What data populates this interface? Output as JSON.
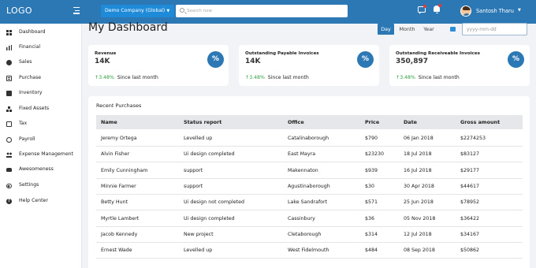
{
  "header": {
    "logo": "LOGO",
    "company": "Demo Company (Global)",
    "search_placeholder": "Search now",
    "user_name": "Santosh Tharu"
  },
  "sidebar": {
    "items": [
      {
        "label": "Dashboard",
        "icon": "grid-icon"
      },
      {
        "label": "Financial",
        "icon": "bar-chart-icon"
      },
      {
        "label": "Sales",
        "icon": "sales-icon"
      },
      {
        "label": "Purchase",
        "icon": "purchase-icon"
      },
      {
        "label": "Inventory",
        "icon": "inventory-icon"
      },
      {
        "label": "Fixed Assets",
        "icon": "assets-icon"
      },
      {
        "label": "Tax",
        "icon": "tax-icon"
      },
      {
        "label": "Payroll",
        "icon": "payroll-icon"
      },
      {
        "label": "Expense Management",
        "icon": "people-icon"
      },
      {
        "label": "Awesomeness",
        "icon": "car-icon"
      },
      {
        "label": "Settings",
        "icon": "toggle-icon"
      },
      {
        "label": "Help Center",
        "icon": "help-icon"
      }
    ]
  },
  "main": {
    "title": "My Dashboard",
    "range_tabs": [
      "Day",
      "Month",
      "Year"
    ],
    "active_range": "Day",
    "date_placeholder": "yyyy-mm-dd",
    "accent_color": "#2c78b5",
    "stats": [
      {
        "title": "Revenue",
        "value": "14K",
        "change": "3.48%",
        "caption": "Since last month"
      },
      {
        "title": "Outstanding Payable Invoices",
        "value": "14K",
        "change": "3.48%",
        "caption": "Since last month"
      },
      {
        "title": "Outstanding Receiveable Invoices",
        "value": "350,897",
        "change": "3.48%",
        "caption": "Since last month"
      }
    ],
    "purchases": {
      "title": "Recent Purchases",
      "columns": [
        "Name",
        "Status report",
        "Office",
        "Price",
        "Date",
        "Gross amount"
      ],
      "rows": [
        [
          "Jeremy Ortega",
          "Levelled up",
          "Catalinaborough",
          "$790",
          "06 Jan 2018",
          "$2274253"
        ],
        [
          "Alvin Fisher",
          "Ui design completed",
          "East Mayra",
          "$23230",
          "18 Jul 2018",
          "$83127"
        ],
        [
          "Emily Cunningham",
          "support",
          "Makennaton",
          "$939",
          "16 Jul 2018",
          "$29177"
        ],
        [
          "Minnie Farmer",
          "support",
          "Agustinaborough",
          "$30",
          "30 Apr 2018",
          "$44617"
        ],
        [
          "Betty Hunt",
          "Ui design not completed",
          "Lake Sandrafort",
          "$571",
          "25 Jun 2018",
          "$78952"
        ],
        [
          "Myrtle Lambert",
          "Ui design completed",
          "Cassinbury",
          "$36",
          "05 Nov 2018",
          "$36422"
        ],
        [
          "Jacob Kennedy",
          "New project",
          "Cletaborough",
          "$314",
          "12 Jul 2018",
          "$34167"
        ],
        [
          "Ernest Wade",
          "Levelled up",
          "West Fidelmouth",
          "$484",
          "08 Sep 2018",
          "$50862"
        ]
      ]
    }
  }
}
